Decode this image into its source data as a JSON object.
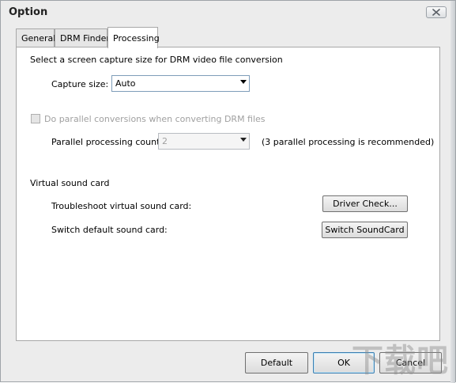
{
  "window": {
    "title": "Option"
  },
  "tabs": [
    {
      "label": "General",
      "active": false
    },
    {
      "label": "DRM Finder",
      "active": false
    },
    {
      "label": "Processing",
      "active": true
    }
  ],
  "processing": {
    "capture_heading": "Select a screen capture size for DRM video file conversion",
    "capture_size_label": "Capture size:",
    "capture_size_value": "Auto",
    "parallel_checkbox_label": "Do parallel conversions when converting DRM files",
    "parallel_checked": false,
    "parallel_count_label": "Parallel processing count:",
    "parallel_count_value": "2",
    "parallel_hint": "(3 parallel processing is recommended)",
    "sound_heading": "Virtual sound card",
    "troubleshoot_label": "Troubleshoot virtual sound card:",
    "driver_check_button": "Driver Check...",
    "switch_default_label": "Switch default sound card:",
    "switch_soundcard_button": "Switch SoundCard"
  },
  "footer": {
    "default_button": "Default",
    "ok_button": "OK",
    "cancel_button": "Cancel"
  },
  "watermark": "下载吧",
  "colors": {
    "panel_bg": "#ffffff",
    "window_bg": "#ececec",
    "disabled_text": "#a0a0a0",
    "focus_border": "#3c7fb1"
  }
}
